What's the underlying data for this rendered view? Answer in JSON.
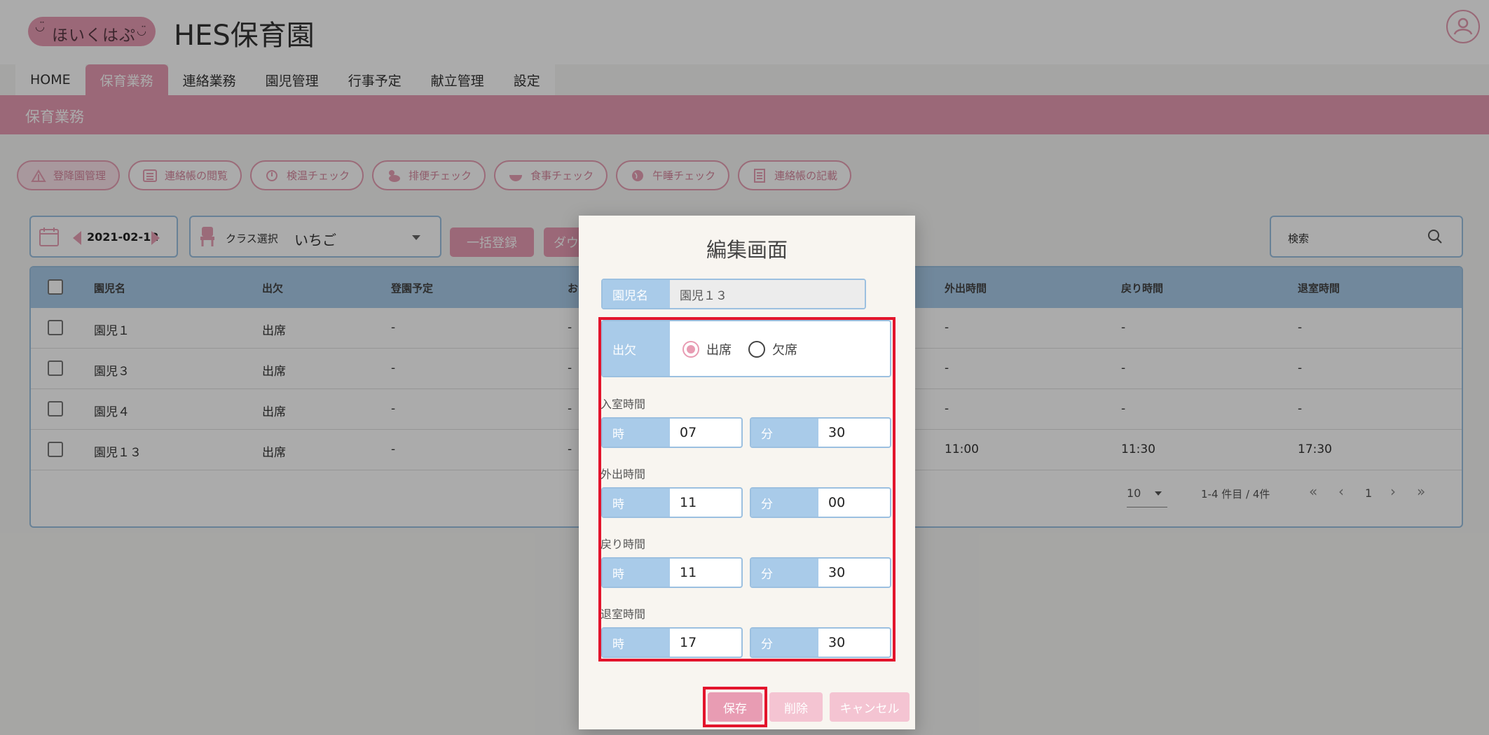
{
  "app": {
    "logo_text": "ほいくはぷ",
    "title": "HES保育園"
  },
  "nav": {
    "tabs": [
      "HOME",
      "保育業務",
      "連絡業務",
      "園児管理",
      "行事予定",
      "献立管理",
      "設定"
    ],
    "active": "保育業務"
  },
  "section": {
    "title": "保育業務"
  },
  "toolbar": {
    "buttons": [
      "登降園管理",
      "連絡帳の閲覧",
      "検温チェック",
      "排便チェック",
      "食事チェック",
      "午睡チェック",
      "連絡帳の記載"
    ]
  },
  "filters": {
    "date": "2021-02-12",
    "class_label": "クラス選択",
    "class_value": "いちご",
    "bulk_register": "一括登録",
    "download": "ダウ",
    "search_placeholder": "検索"
  },
  "table": {
    "columns": [
      "園児名",
      "出欠",
      "登園予定",
      "お",
      "外出時間",
      "戻り時間",
      "退室時間"
    ],
    "rows": [
      {
        "name": "園児１",
        "attendance": "出席",
        "plan": "-",
        "o": "-",
        "out": "-",
        "back": "-",
        "leave": "-"
      },
      {
        "name": "園児３",
        "attendance": "出席",
        "plan": "-",
        "o": "-",
        "out": "-",
        "back": "-",
        "leave": "-"
      },
      {
        "name": "園児４",
        "attendance": "出席",
        "plan": "-",
        "o": "-",
        "out": "-",
        "back": "-",
        "leave": "-"
      },
      {
        "name": "園児１３",
        "attendance": "出席",
        "plan": "-",
        "o": "-",
        "out": "11:00",
        "back": "11:30",
        "leave": "17:30"
      }
    ],
    "per_page": "10",
    "range": "1-4 件目 / 4件",
    "page": "1"
  },
  "modal": {
    "title": "編集画面",
    "child_label": "園児名",
    "child_value": "園児１３",
    "attendance_label": "出欠",
    "present_label": "出席",
    "absent_label": "欠席",
    "selected": "出席",
    "hour_label": "時",
    "minute_label": "分",
    "entry": {
      "label": "入室時間",
      "hour": "07",
      "minute": "30"
    },
    "out": {
      "label": "外出時間",
      "hour": "11",
      "minute": "00"
    },
    "back": {
      "label": "戻り時間",
      "hour": "11",
      "minute": "30"
    },
    "leave": {
      "label": "退室時間",
      "hour": "17",
      "minute": "30"
    },
    "save": "保存",
    "delete": "削除",
    "cancel": "キャンセル"
  }
}
